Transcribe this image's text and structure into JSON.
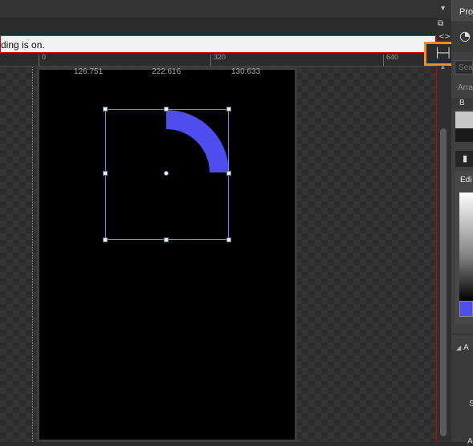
{
  "banner": {
    "text": "ding is on."
  },
  "ruler": {
    "ticks": [
      "0",
      "320",
      "640"
    ]
  },
  "dimensions": [
    "126.751",
    "222.616",
    "130.633"
  ],
  "shape": {
    "fill": "#4d4df0",
    "type": "quarter-ring"
  },
  "highlight": {
    "color": "#ff8a1e",
    "icon": "width-resize-icon"
  },
  "panel": {
    "title": "Pro",
    "search_placeholder": "Sea",
    "arrange_label": "Arra",
    "brush_label": "B",
    "editor_label": "Edi",
    "appearance_label": "A",
    "s_label": "S",
    "a_label": "A"
  }
}
